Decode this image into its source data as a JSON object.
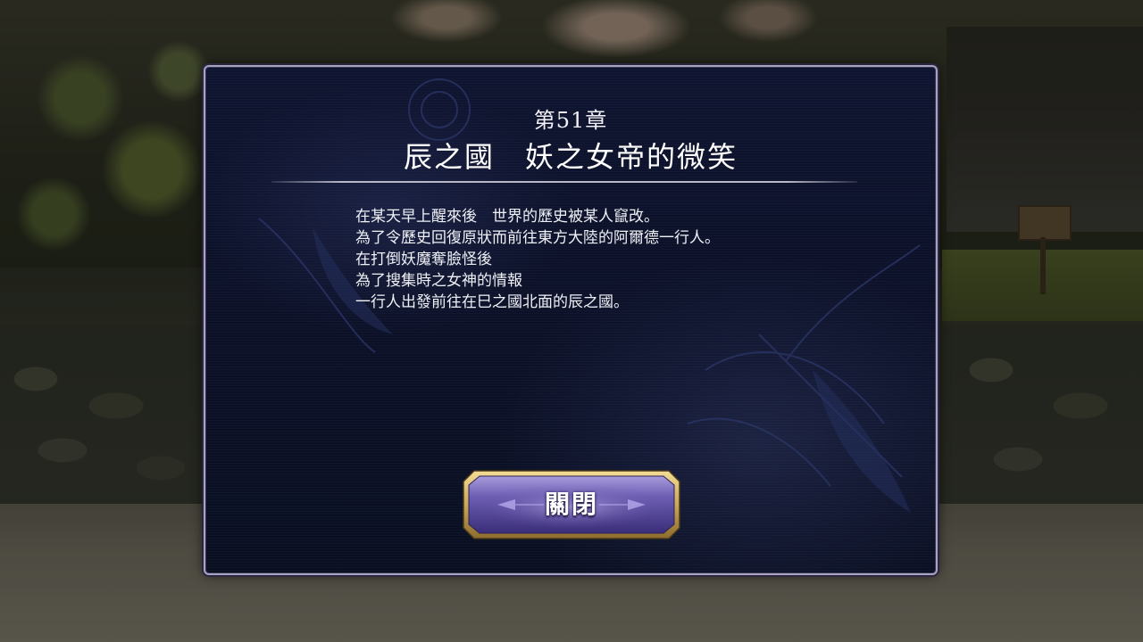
{
  "dialog": {
    "chapter_number": "第51章",
    "chapter_title": "辰之國　妖之女帝的微笑",
    "story_lines": [
      "在某天早上醒來後　世界的歷史被某人竄改。",
      "為了令歷史回復原狀而前往東方大陸的阿爾德一行人。",
      "在打倒妖魔奪臉怪後",
      "為了搜集時之女神的情報",
      "一行人出發前往在巳之國北面的辰之國。"
    ],
    "close_label": "關閉"
  },
  "colors": {
    "panel_background": "#0c1128",
    "panel_border": "#a9a3c2",
    "button_gold": "#c9a85a",
    "button_purple": "#5b4c9c",
    "text": "#eef0f6"
  }
}
